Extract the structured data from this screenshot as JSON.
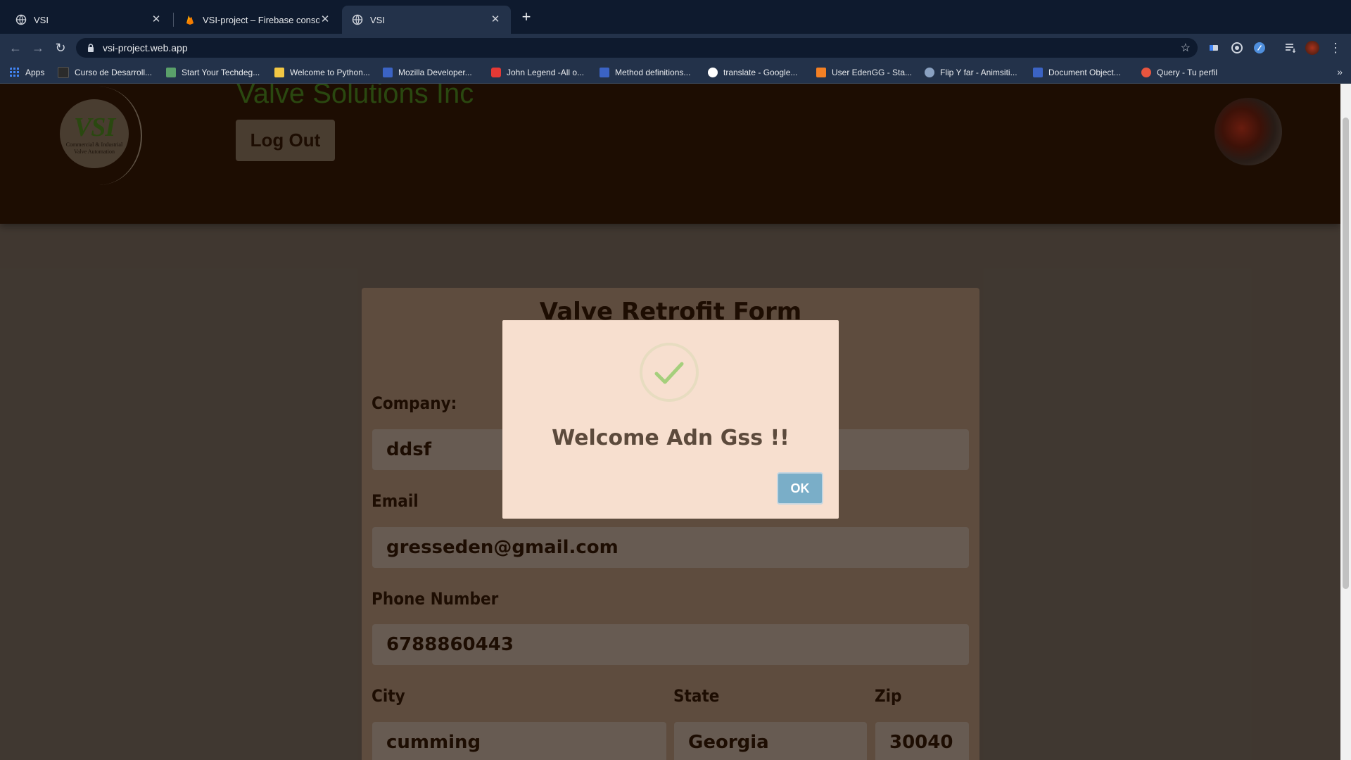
{
  "browser": {
    "tabs": [
      {
        "title": "VSI",
        "active": false
      },
      {
        "title": "VSI-project – Firebase console",
        "active": false
      },
      {
        "title": "VSI",
        "active": true
      }
    ],
    "new_tab_label": "+",
    "url": "vsi-project.web.app",
    "bookmarks": [
      {
        "label": "Apps",
        "color": "#4285f4"
      },
      {
        "label": "Curso de Desarroll...",
        "color": "#2b2b2b"
      },
      {
        "label": "Start Your Techdeg...",
        "color": "#5aa06a"
      },
      {
        "label": "Welcome to Python...",
        "color": "#f2c744"
      },
      {
        "label": "Mozilla Developer...",
        "color": "#3b63c4"
      },
      {
        "label": "John Legend -All o...",
        "color": "#e53935"
      },
      {
        "label": "Method definitions...",
        "color": "#3b63c4"
      },
      {
        "label": "translate - Google...",
        "color": "#ffffff"
      },
      {
        "label": "User EdenGG - Sta...",
        "color": "#f48024"
      },
      {
        "label": "Flip Y far - Animsiti...",
        "color": "#8aa1c1"
      },
      {
        "label": "Document Object...",
        "color": "#3b63c4"
      },
      {
        "label": "Query - Tu perfil",
        "color": "#e8553f"
      }
    ],
    "bookmarks_more": "»"
  },
  "header": {
    "brand_title": "Valve Solutions Inc",
    "logo_mark": "VSI",
    "logo_line1": "Commercial & Industrial",
    "logo_line2": "Valve Automation",
    "logout_label": "Log Out"
  },
  "form": {
    "title": "Valve Retrofit Form",
    "company_label": "Company:",
    "company_value": "ddsf",
    "email_label": "Email",
    "email_value": "gresseden@gmail.com",
    "phone_label": "Phone Number",
    "phone_value": "6788860443",
    "city_label": "City",
    "city_value": "cumming",
    "state_label": "State",
    "state_value": "Georgia",
    "zip_label": "Zip",
    "zip_value": "30040"
  },
  "modal": {
    "title": "Welcome Adn Gss !!",
    "ok_label": "OK",
    "icon": "success-check-icon"
  },
  "colors": {
    "header_bg": "#2c1404",
    "brand_green": "#3e6a18",
    "card_bg": "#8b705c",
    "modal_bg": "#f7dfcf",
    "ok_button": "#7aaec8"
  }
}
